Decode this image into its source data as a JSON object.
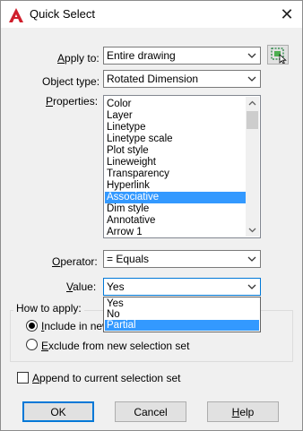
{
  "window": {
    "title": "Quick Select",
    "close_glyph": "✕"
  },
  "fields": {
    "apply_to": {
      "label_pre": "",
      "label_key": "A",
      "label_post": "pply to:",
      "value": "Entire drawing"
    },
    "object_type": {
      "label_pre": "Ob",
      "label_key": "j",
      "label_post": "ect type:",
      "value": "Rotated Dimension"
    },
    "properties": {
      "label_pre": "",
      "label_key": "P",
      "label_post": "roperties:",
      "items": [
        "Color",
        "Layer",
        "Linetype",
        "Linetype scale",
        "Plot style",
        "Lineweight",
        "Transparency",
        "Hyperlink",
        "Associative",
        "Dim style",
        "Annotative",
        "Arrow 1"
      ],
      "selected": "Associative"
    },
    "operator": {
      "label_pre": "",
      "label_key": "O",
      "label_post": "perator:",
      "value": "= Equals"
    },
    "value": {
      "label_pre": "",
      "label_key": "V",
      "label_post": "alue:",
      "current": "Yes",
      "options": [
        "Yes",
        "No",
        "Partial"
      ],
      "highlighted": "Partial"
    }
  },
  "how_to_apply": {
    "title": "How to apply:",
    "include": {
      "label_pre": "",
      "label_key": "I",
      "label_post": "nclude in new",
      "checked": true
    },
    "exclude": {
      "label_pre": "",
      "label_key": "E",
      "label_post": "xclude from new selection set",
      "checked": false
    }
  },
  "append": {
    "label_pre": "",
    "label_key": "A",
    "label_post": "ppend to current selection set",
    "checked": false
  },
  "buttons": {
    "ok": "OK",
    "cancel": "Cancel",
    "help_pre": "",
    "help_key": "H",
    "help_post": "elp"
  },
  "colors": {
    "accent": "#0078d7",
    "selection": "#3399ff",
    "app_icon": "#d01f2c"
  },
  "icons": {
    "app": "autocad-logo-icon",
    "select_objects": "select-objects-icon"
  }
}
